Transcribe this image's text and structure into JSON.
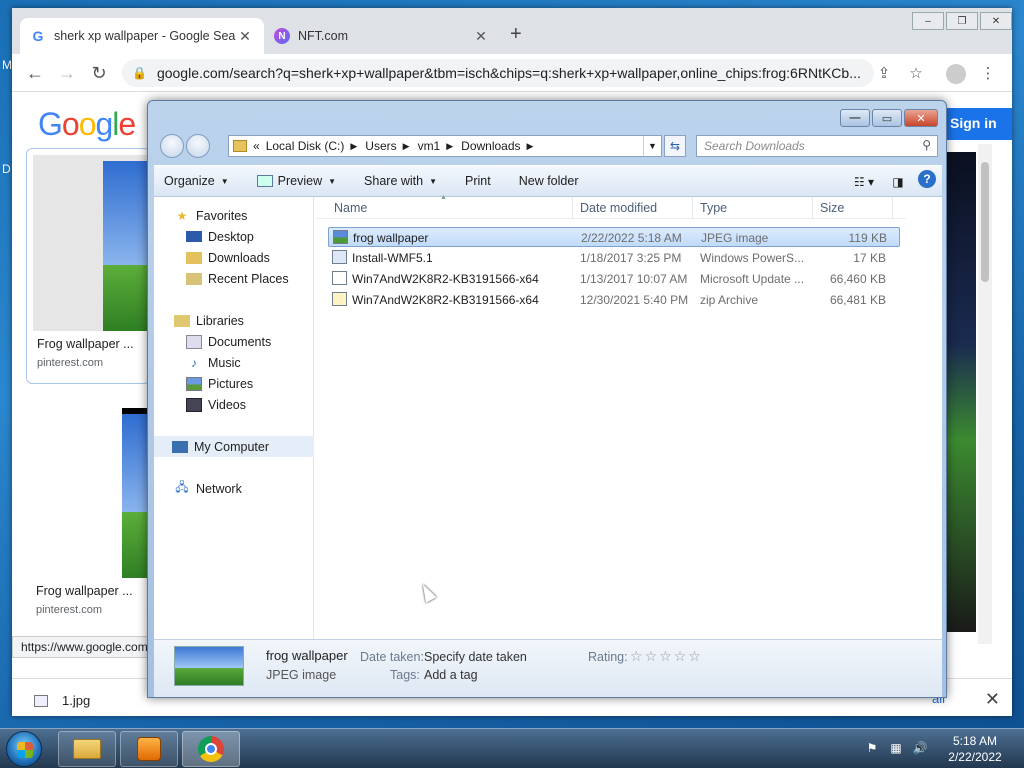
{
  "desktop": {
    "frag_m": "M",
    "frag_d": "D"
  },
  "browser": {
    "window_controls": {
      "minimize": "–",
      "restore": "❐",
      "close": "✕"
    },
    "tabs": [
      {
        "title": "sherk xp wallpaper - Google Search",
        "favicon": "google-g-icon"
      },
      {
        "title": "NFT.com",
        "favicon": "nft-icon"
      }
    ],
    "favicon_google": "G",
    "favicon_nft": "N",
    "tab_close": "✕",
    "new_tab": "+",
    "url": "google.com/search?q=sherk+xp+wallpaper&tbm=isch&chips=q:sherk+xp+wallpaper,online_chips:frog:6RNtKCb...",
    "page": {
      "sign_in": "Sign in",
      "results": [
        {
          "caption": "Frog wallpaper ...",
          "source": "pinterest.com"
        },
        {
          "caption": "Frog wallpaper ...",
          "source": "pinterest.com"
        }
      ],
      "status_url": "https://www.google.com/...",
      "download_file": "1.jpg",
      "download_show_all": "all"
    }
  },
  "explorer": {
    "window_controls": {
      "minimize": "—",
      "maximize": "▭",
      "close": "✕"
    },
    "breadcrumbs": [
      "«",
      "Local Disk (C:)",
      "Users",
      "vm1",
      "Downloads"
    ],
    "search_placeholder": "Search Downloads",
    "toolbar": {
      "organize": "Organize",
      "preview": "Preview",
      "share_with": "Share with",
      "print": "Print",
      "new_folder": "New folder"
    },
    "nav": {
      "favorites": "Favorites",
      "desktop": "Desktop",
      "downloads": "Downloads",
      "recent_places": "Recent Places",
      "libraries": "Libraries",
      "documents": "Documents",
      "music": "Music",
      "pictures": "Pictures",
      "videos": "Videos",
      "my_computer": "My Computer",
      "network": "Network"
    },
    "columns": {
      "name": "Name",
      "date_modified": "Date modified",
      "type": "Type",
      "size": "Size"
    },
    "files": [
      {
        "name": "frog wallpaper",
        "date": "2/22/2022 5:18 AM",
        "type": "JPEG image",
        "size": "119 KB"
      },
      {
        "name": "Install-WMF5.1",
        "date": "1/18/2017 3:25 PM",
        "type": "Windows PowerS...",
        "size": "17 KB"
      },
      {
        "name": "Win7AndW2K8R2-KB3191566-x64",
        "date": "1/13/2017 10:07 AM",
        "type": "Microsoft Update ...",
        "size": "66,460 KB"
      },
      {
        "name": "Win7AndW2K8R2-KB3191566-x64",
        "date": "12/30/2021 5:40 PM",
        "type": "zip Archive",
        "size": "66,481 KB"
      }
    ],
    "details": {
      "name": "frog wallpaper",
      "type": "JPEG image",
      "date_taken_label": "Date taken:",
      "date_taken_value": "Specify date taken",
      "tags_label": "Tags:",
      "tags_value": "Add a tag",
      "rating_label": "Rating:",
      "rating_stars": 0
    }
  },
  "taskbar": {
    "time": "5:18 AM",
    "date": "2/22/2022"
  }
}
